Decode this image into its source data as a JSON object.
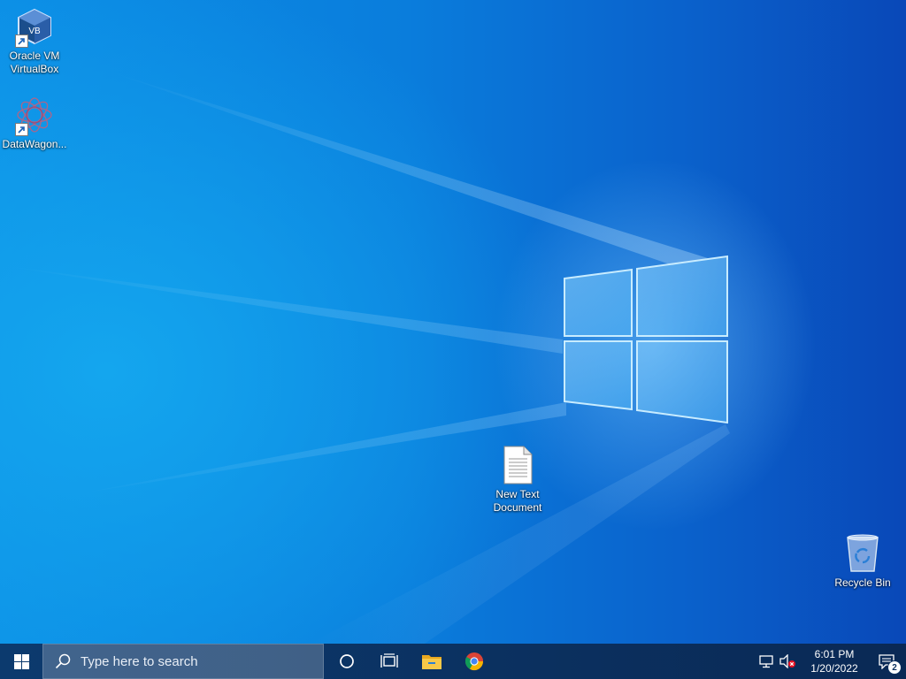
{
  "desktop": {
    "icons": [
      {
        "label": "Oracle VM\nVirtualBox",
        "icon": "virtualbox-icon",
        "shortcut": true
      },
      {
        "label": "DataWagon...",
        "icon": "datawagon-icon",
        "shortcut": true
      },
      {
        "label": "New Text\nDocument",
        "icon": "text-document-icon",
        "shortcut": false
      },
      {
        "label": "Recycle Bin",
        "icon": "recycle-bin-icon",
        "shortcut": false
      }
    ]
  },
  "taskbar": {
    "search_placeholder": "Type here to search",
    "pinned": [
      "cortana-icon",
      "task-view-icon",
      "file-explorer-icon",
      "chrome-icon"
    ],
    "tray": {
      "time": "6:01 PM",
      "date": "1/20/2022",
      "notification_count": "2"
    }
  },
  "colors": {
    "taskbar": "#0b305f",
    "desktop_accent": "#0a7ddc",
    "chrome_red": "#db4437",
    "chrome_green": "#0f9d58",
    "chrome_yellow": "#f4b400",
    "chrome_blue": "#4285f4",
    "folder_yellow": "#f7c948"
  }
}
